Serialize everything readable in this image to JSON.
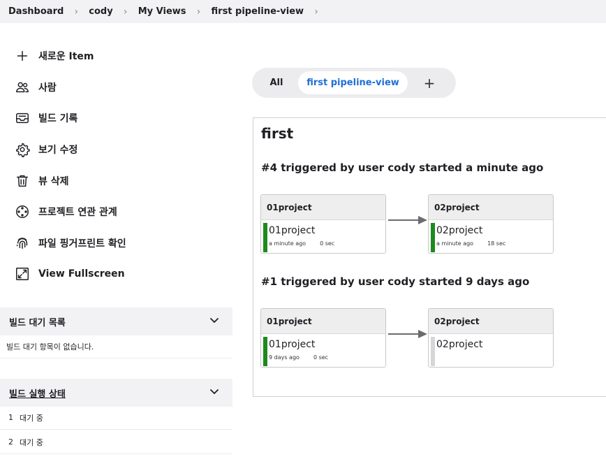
{
  "breadcrumb": {
    "items": [
      "Dashboard",
      "cody",
      "My Views",
      "first pipeline-view"
    ]
  },
  "tasks": [
    {
      "label": "새로운 Item",
      "icon": "plus-icon"
    },
    {
      "label": "사람",
      "icon": "people-icon"
    },
    {
      "label": "빌드 기록",
      "icon": "inbox-icon"
    },
    {
      "label": "보기 수정",
      "icon": "gear-icon"
    },
    {
      "label": "뷰 삭제",
      "icon": "trash-icon"
    },
    {
      "label": "프로젝트 연관 관계",
      "icon": "relationship-icon"
    },
    {
      "label": "파일 핑거프린트 확인",
      "icon": "fingerprint-icon"
    },
    {
      "label": "View Fullscreen",
      "icon": "fullscreen-icon"
    }
  ],
  "build_queue": {
    "title": "빌드 대기 목록",
    "empty_text": "빌드 대기 항목이 없습니다."
  },
  "executors": {
    "title": "빌드 실행 상태",
    "rows": [
      {
        "num": "1",
        "status": "대기 중"
      },
      {
        "num": "2",
        "status": "대기 중"
      }
    ]
  },
  "tabs": {
    "all": "All",
    "active": "first pipeline-view",
    "add": "+"
  },
  "pipeline": {
    "title": "first",
    "runs": [
      {
        "title": "#4 triggered by user cody started a minute ago",
        "stages": [
          {
            "header": "01project",
            "name": "01project",
            "time": "a minute ago",
            "duration": "0 sec",
            "status": "success"
          },
          {
            "header": "02project",
            "name": "02project",
            "time": "a minute ago",
            "duration": "18 sec",
            "status": "success"
          }
        ]
      },
      {
        "title": "#1 triggered by user cody started 9 days ago",
        "stages": [
          {
            "header": "01project",
            "name": "01project",
            "time": "9 days ago",
            "duration": "0 sec",
            "status": "success"
          },
          {
            "header": "02project",
            "name": "02project",
            "time": "",
            "duration": "",
            "status": "not-built"
          }
        ]
      }
    ]
  },
  "colors": {
    "success": "#1e8a1e",
    "not_built": "#d6d6d8",
    "active_tab_text": "#1f6fd6",
    "panel_bg": "#f2f2f4"
  }
}
